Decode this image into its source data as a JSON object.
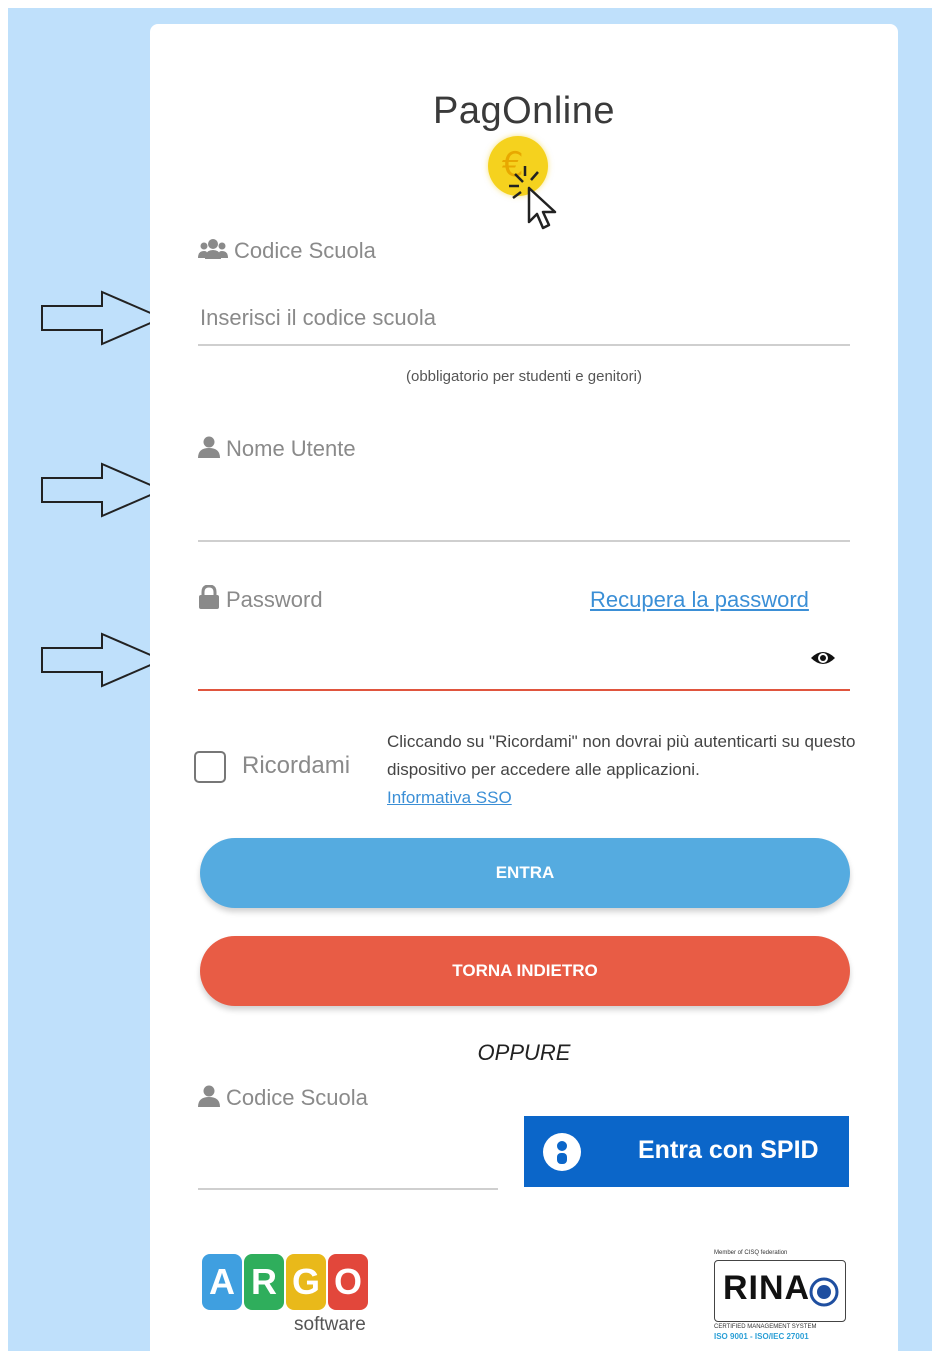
{
  "app": {
    "title": "PagOnline"
  },
  "school_code": {
    "label": "Codice Scuola",
    "placeholder": "Inserisci il codice scuola",
    "value": "",
    "hint": "(obbligatorio per studenti e genitori)"
  },
  "username": {
    "label": "Nome Utente",
    "value": ""
  },
  "password": {
    "label": "Password",
    "value": "",
    "recover_link": "Recupera la password"
  },
  "remember": {
    "label": "Ricordami",
    "checked": false,
    "note": "Cliccando su \"Ricordami\" non dovrai più autenticarti su questo dispositivo per accedere alle applicazioni.",
    "link": "Informativa SSO"
  },
  "buttons": {
    "login": "ENTRA",
    "back": "TORNA INDIETRO"
  },
  "separator": "OPPURE",
  "spid": {
    "school_code_label": "Codice Scuola",
    "school_code_value": "",
    "button_label": "Entra con SPID"
  },
  "footer": {
    "argo_letters": [
      "A",
      "R",
      "G",
      "O"
    ],
    "argo_sub": "software",
    "rina_top": "Member of CISQ federation",
    "rina_word": "RINA",
    "rina_bottom": "CERTIFIED MANAGEMENT SYSTEM",
    "rina_bottom2": "ISO 9001 - ISO/IEC 27001"
  },
  "colors": {
    "background": "#bfe0fb",
    "login_button": "#55abe0",
    "back_button": "#e85c45",
    "spid_button": "#0b66c9",
    "link": "#3b8fd6",
    "password_underline": "#e0553e"
  },
  "icons": {
    "school_code": "users-icon",
    "username": "user-icon",
    "password": "lock-icon",
    "show_password": "eye-icon",
    "spid": "spid-user-icon",
    "logo": "euro-coin-click-icon",
    "annotations": "outline-arrow-icon"
  }
}
